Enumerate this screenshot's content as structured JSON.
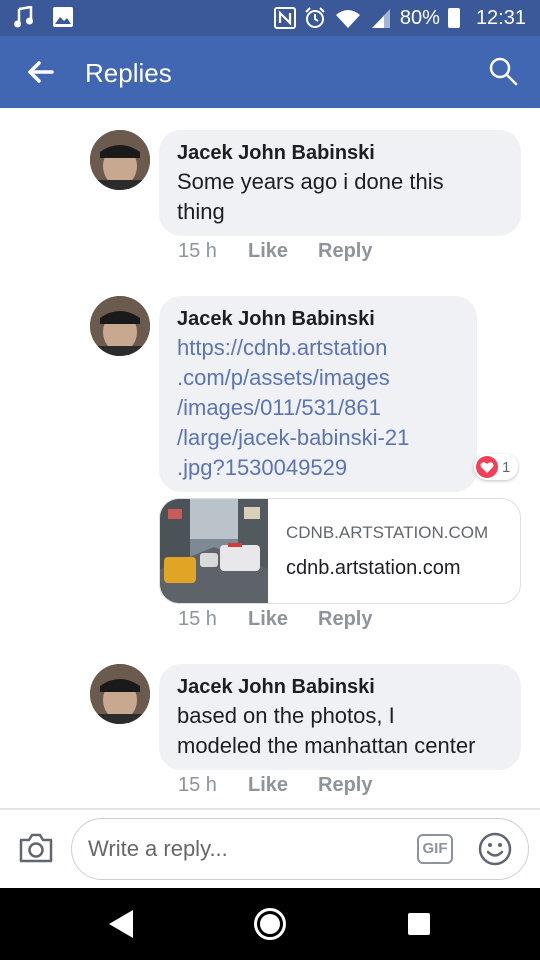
{
  "status_bar": {
    "battery": "80%",
    "time": "12:31",
    "icons": [
      "music-note-icon",
      "image-icon",
      "nfc-icon",
      "alarm-icon",
      "wifi-icon",
      "signal-icon",
      "battery-icon"
    ]
  },
  "header": {
    "title": "Replies",
    "back_icon": "arrow-left-icon",
    "search_icon": "search-icon"
  },
  "comments": [
    {
      "author": "Jacek John Babinski",
      "text": "Some years ago i done this\nthing",
      "time": "15 h",
      "like_label": "Like",
      "reply_label": "Reply"
    },
    {
      "author": "Jacek John Babinski",
      "text": "https://cdnb.artstation\n.com/p/assets/images\n/images/011/531/861\n/large/jacek-babinski-21\n.jpg?1530049529",
      "reaction_count": "1",
      "link_preview": {
        "domain": "CDNB.ARTSTATION.COM",
        "title": "cdnb.artstation.com"
      },
      "time": "15 h",
      "like_label": "Like",
      "reply_label": "Reply"
    },
    {
      "author": "Jacek John Babinski",
      "text": "based on the photos, I\nmodeled the manhattan center",
      "time": "15 h",
      "like_label": "Like",
      "reply_label": "Reply"
    }
  ],
  "composer": {
    "placeholder": "Write a reply...",
    "gif_label": "GIF"
  },
  "colors": {
    "status_bar": "#3b5998",
    "app_bar": "#4267b2",
    "bubble": "#f0f1f4",
    "link_text": "#5b74b3",
    "reaction_heart": "#f33e58"
  }
}
